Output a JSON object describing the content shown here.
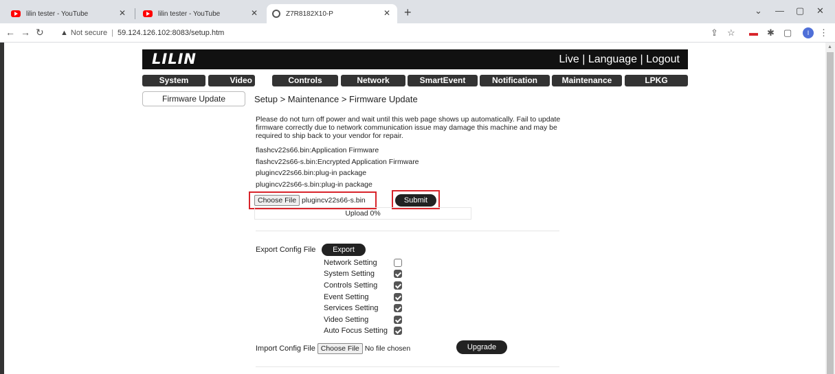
{
  "browser": {
    "tabs": [
      {
        "title": "lilin tester - YouTube",
        "active": false
      },
      {
        "title": "lilin tester - YouTube",
        "active": false
      },
      {
        "title": "Z7R8182X10-P",
        "active": true
      }
    ],
    "address": {
      "security": "Not secure",
      "url": "59.124.126.102:8083/setup.htm"
    },
    "profile_initial": "I"
  },
  "header": {
    "logo": "LILIN",
    "links": [
      "Live",
      "Language",
      "Logout"
    ]
  },
  "menu": [
    "System",
    "Video",
    "Controls",
    "Network",
    "SmartEvent",
    "Notification",
    "Maintenance",
    "LPKG"
  ],
  "sidebar": {
    "item": "Firmware Update"
  },
  "breadcrumb": "Setup > Maintenance > Firmware Update",
  "firmware": {
    "warning": "Please do not turn off power and wait until this web page shows up automatically. Fail to update firmware correctly due to network communication issue may damage this machine and may be required to ship back to your vendor for repair.",
    "files": [
      "flashcv22s66.bin:Application Firmware",
      "flashcv22s66-s.bin:Encrypted Application Firmware",
      "plugincv22s66.bin:plug-in package",
      "plugincv22s66-s.bin:plug-in package"
    ],
    "choose_file_label": "Choose File",
    "chosen_file": "plugincv22s66-s.bin",
    "submit_label": "Submit",
    "upload_status": "Upload 0%"
  },
  "export": {
    "label": "Export Config File",
    "button": "Export",
    "settings": [
      {
        "name": "Network Setting",
        "checked": false
      },
      {
        "name": "System Setting",
        "checked": true
      },
      {
        "name": "Controls Setting",
        "checked": true
      },
      {
        "name": "Event Setting",
        "checked": true
      },
      {
        "name": "Services Setting",
        "checked": true
      },
      {
        "name": "Video Setting",
        "checked": true
      },
      {
        "name": "Auto Focus Setting",
        "checked": true
      }
    ]
  },
  "import": {
    "label": "Import Config File",
    "choose_file_label": "Choose File",
    "chosen_file": "No file chosen",
    "button": "Upgrade"
  },
  "colors": {
    "highlight": "#d8232a",
    "header_bg": "#111111",
    "menu_bg": "#333333"
  }
}
